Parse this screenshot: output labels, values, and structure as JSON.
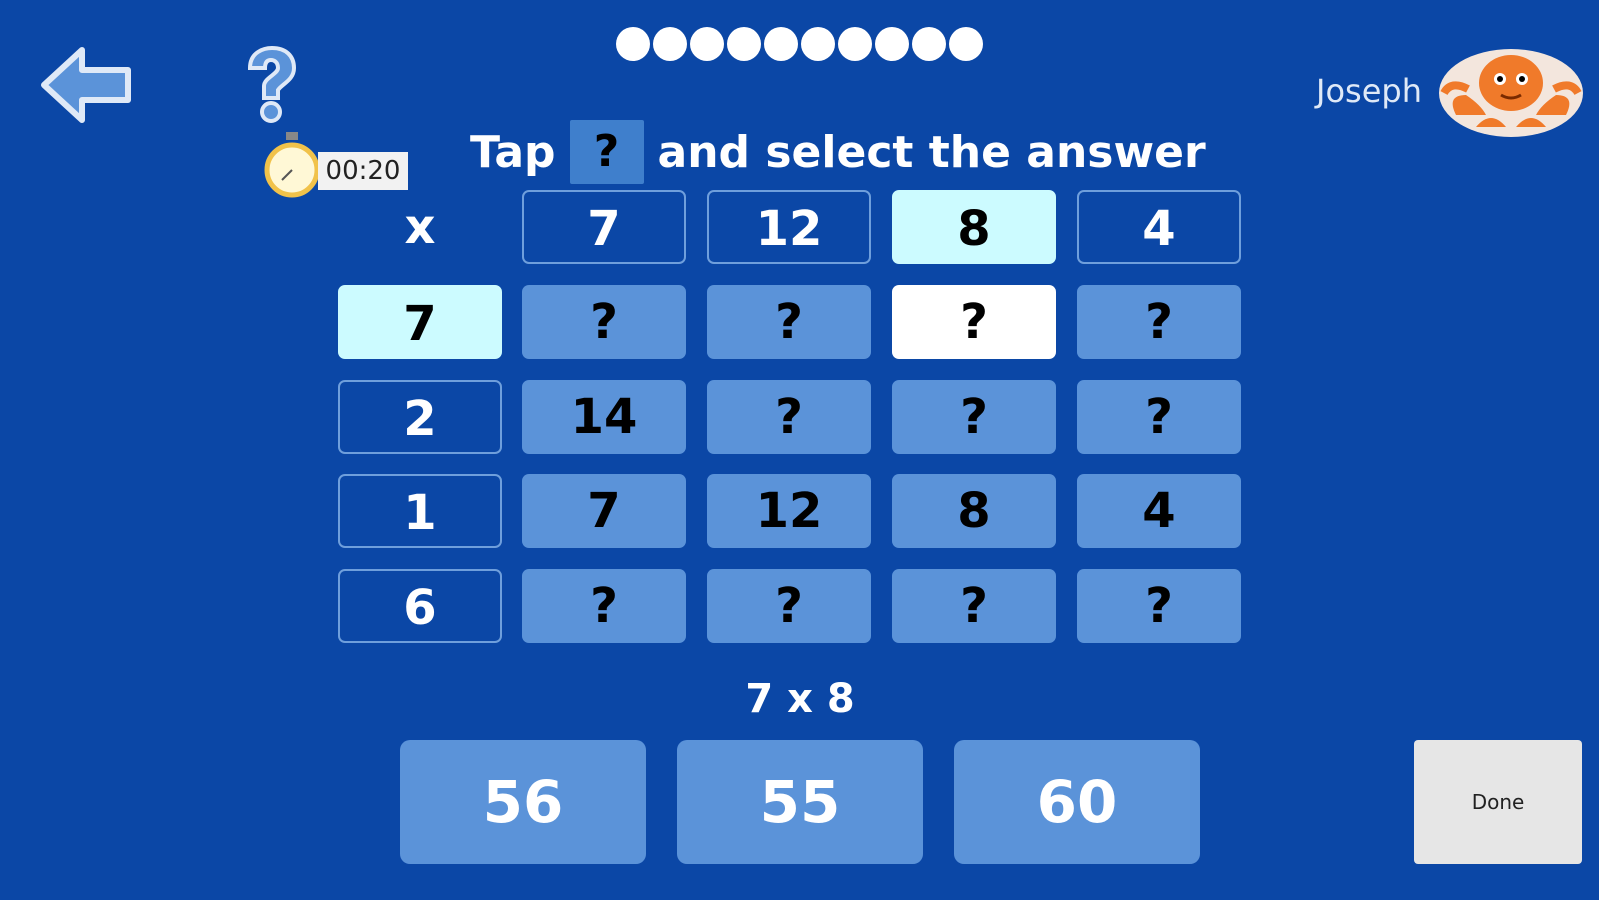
{
  "progress": {
    "total": 10
  },
  "timer": {
    "value": "00:20"
  },
  "instruction": {
    "before": "Tap",
    "marker": "?",
    "after": "and select the answer"
  },
  "user": {
    "name": "Joseph",
    "avatar_icon": "octopus-icon"
  },
  "table": {
    "operator": "x",
    "selected_column": 2,
    "selected_row": 0,
    "column_headers": [
      "7",
      "12",
      "8",
      "4"
    ],
    "row_headers": [
      "7",
      "2",
      "1",
      "6"
    ],
    "cells": [
      [
        "?",
        "?",
        "?",
        "?"
      ],
      [
        "14",
        "?",
        "?",
        "?"
      ],
      [
        "7",
        "12",
        "8",
        "4"
      ],
      [
        "?",
        "?",
        "?",
        "?"
      ]
    ]
  },
  "question": {
    "equation": "7 x 8"
  },
  "answers": [
    "56",
    "55",
    "60"
  ],
  "done_label": "Done",
  "colors": {
    "background": "#0b47a6",
    "cell": "#5b93d9",
    "header_selected": "#ccfbff",
    "cell_selected": "#ffffff",
    "avatar": "#f07a2a"
  }
}
